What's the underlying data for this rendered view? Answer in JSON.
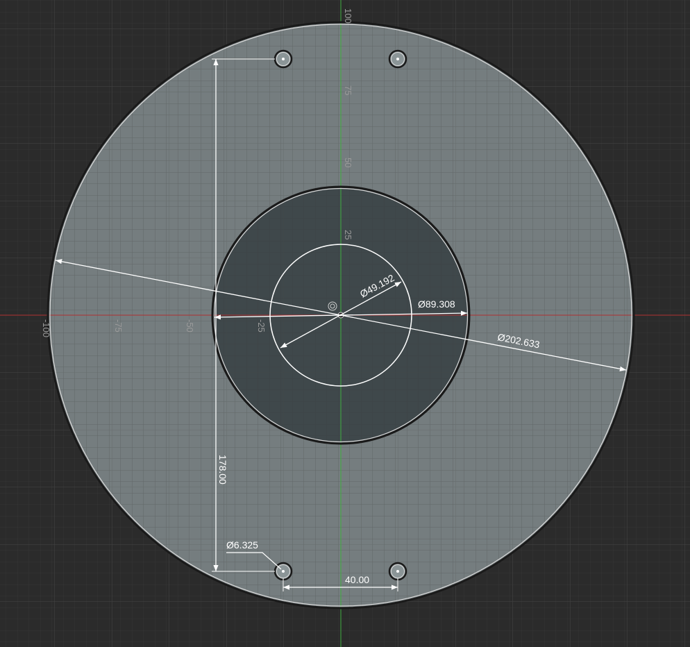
{
  "sketch": {
    "axis_ticks": {
      "x": [
        "-100",
        "-75",
        "-50",
        "-25"
      ],
      "y": [
        "100",
        "75",
        "50",
        "25"
      ]
    },
    "dimensions": {
      "outer_diameter": "Ø202.633",
      "middle_diameter": "Ø89.308",
      "inner_diameter": "Ø49.192",
      "hole_diameter": "Ø6.325",
      "vertical_spacing": "178.00",
      "horizontal_spacing": "40.00"
    },
    "colors": {
      "background": "#2b2b2b",
      "grid_minor": "#363636",
      "grid_major": "#444444",
      "x_axis": "#b03030",
      "y_axis": "#3fae3f",
      "outer_face": "#7f8a8c",
      "inner_face": "#3a4246",
      "dimension": "#ffffff"
    }
  }
}
